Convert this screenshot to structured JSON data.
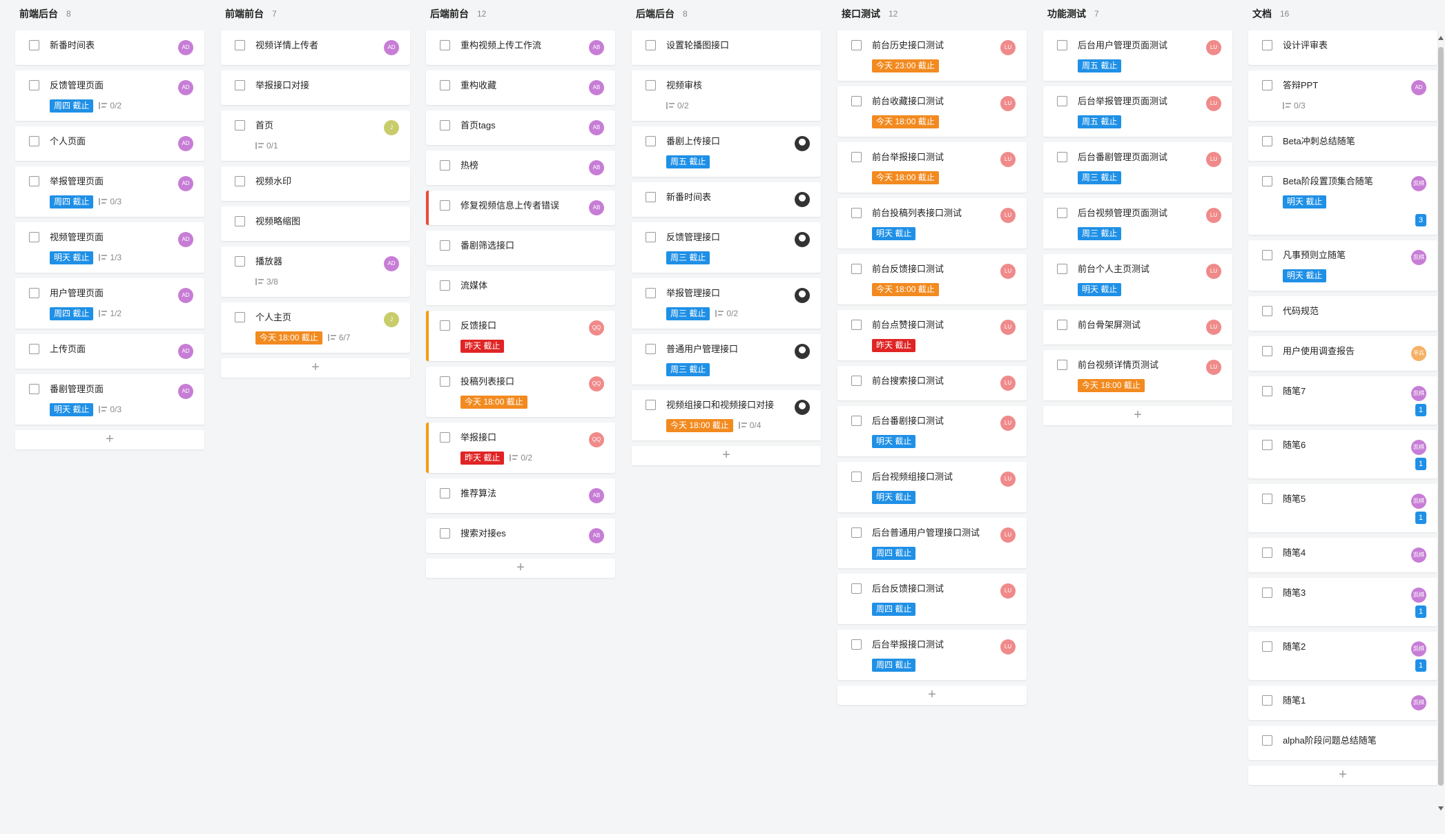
{
  "columns": [
    {
      "id": "col1",
      "title": "前端后台",
      "count": "8",
      "cards": [
        {
          "title": "新番时间表",
          "avatar": "AD",
          "avatar_color": "#c77dd6"
        },
        {
          "title": "反馈管理页面",
          "tag": "周四 截止",
          "tag_color": "blue",
          "subtasks": "0/2",
          "avatar": "AD",
          "avatar_color": "#c77dd6"
        },
        {
          "title": "个人页面",
          "avatar": "AD",
          "avatar_color": "#c77dd6"
        },
        {
          "title": "举报管理页面",
          "tag": "周四 截止",
          "tag_color": "blue",
          "subtasks": "0/3",
          "avatar": "AD",
          "avatar_color": "#c77dd6"
        },
        {
          "title": "视频管理页面",
          "tag": "明天 截止",
          "tag_color": "blue",
          "subtasks": "1/3",
          "avatar": "AD",
          "avatar_color": "#c77dd6"
        },
        {
          "title": "用户管理页面",
          "tag": "周四 截止",
          "tag_color": "blue",
          "subtasks": "1/2",
          "avatar": "AD",
          "avatar_color": "#c77dd6"
        },
        {
          "title": "上传页面",
          "avatar": "AD",
          "avatar_color": "#c77dd6"
        },
        {
          "title": "番剧管理页面",
          "tag": "明天 截止",
          "tag_color": "blue",
          "subtasks": "0/3",
          "avatar": "AD",
          "avatar_color": "#c77dd6"
        }
      ],
      "add": "+"
    },
    {
      "id": "col2",
      "title": "前端前台",
      "count": "7",
      "cards": [
        {
          "title": "视频详情上传者",
          "avatar": "AD",
          "avatar_color": "#c77dd6"
        },
        {
          "title": "举报接口对接"
        },
        {
          "title": "首页",
          "subtasks": "0/1",
          "avatar": "J",
          "avatar_color": "#c8cc6a"
        },
        {
          "title": "视频水印"
        },
        {
          "title": "视频略缩图"
        },
        {
          "title": "播放器",
          "subtasks": "3/8",
          "avatar": "AD",
          "avatar_color": "#c77dd6"
        },
        {
          "title": "个人主页",
          "tag": "今天 18:00 截止",
          "tag_color": "orange",
          "subtasks": "6/7",
          "avatar": "J",
          "avatar_color": "#c8cc6a"
        }
      ],
      "add": "+"
    },
    {
      "id": "col3",
      "title": "后端前台",
      "count": "12",
      "cards": [
        {
          "title": "重构视频上传工作流",
          "avatar": "AB",
          "avatar_color": "#c77dd6"
        },
        {
          "title": "重构收藏",
          "avatar": "AB",
          "avatar_color": "#c77dd6"
        },
        {
          "title": "首页tags",
          "avatar": "AB",
          "avatar_color": "#c77dd6"
        },
        {
          "title": "热榜",
          "avatar": "AB",
          "avatar_color": "#c77dd6"
        },
        {
          "title": "修复视频信息上传者错误",
          "avatar": "AB",
          "avatar_color": "#c77dd6",
          "accent": "red"
        },
        {
          "title": "番剧筛选接口"
        },
        {
          "title": "流媒体"
        },
        {
          "title": "反馈接口",
          "tag": "昨天 截止",
          "tag_color": "red",
          "avatar": "QQ",
          "avatar_color": "#f08a8a",
          "accent": "orange"
        },
        {
          "title": "投稿列表接口",
          "tag": "今天 18:00 截止",
          "tag_color": "orange",
          "avatar": "QQ",
          "avatar_color": "#f08a8a"
        },
        {
          "title": "举报接口",
          "tag": "昨天 截止",
          "tag_color": "red",
          "subtasks": "0/2",
          "avatar": "QQ",
          "avatar_color": "#f08a8a",
          "accent": "orange"
        },
        {
          "title": "推荐算法",
          "avatar": "AB",
          "avatar_color": "#c77dd6"
        },
        {
          "title": "搜索对接es",
          "avatar": "AB",
          "avatar_color": "#c77dd6"
        }
      ],
      "add": "+"
    },
    {
      "id": "col4",
      "title": "后端后台",
      "count": "8",
      "cards": [
        {
          "title": "设置轮播图接口"
        },
        {
          "title": "视频审核",
          "subtasks": "0/2"
        },
        {
          "title": "番剧上传接口",
          "tag": "周五 截止",
          "tag_color": "blue",
          "avatar_img": true
        },
        {
          "title": "新番时间表",
          "avatar_img": true
        },
        {
          "title": "反馈管理接口",
          "tag": "周三 截止",
          "tag_color": "blue",
          "avatar_img": true
        },
        {
          "title": "举报管理接口",
          "tag": "周三 截止",
          "tag_color": "blue",
          "subtasks": "0/2",
          "avatar_img": true
        },
        {
          "title": "普通用户管理接口",
          "tag": "周三 截止",
          "tag_color": "blue",
          "avatar_img": true
        },
        {
          "title": "视频组接口和视频接口对接",
          "tag": "今天 18:00 截止",
          "tag_color": "orange",
          "subtasks": "0/4",
          "avatar_img": true
        }
      ],
      "add": "+"
    },
    {
      "id": "col5",
      "title": "接口测试",
      "count": "12",
      "cards": [
        {
          "title": "前台历史接口测试",
          "tag": "今天 23:00 截止",
          "tag_color": "orange",
          "avatar": "LU",
          "avatar_color": "#f08a8a"
        },
        {
          "title": "前台收藏接口测试",
          "tag": "今天 18:00 截止",
          "tag_color": "orange",
          "avatar": "LU",
          "avatar_color": "#f08a8a"
        },
        {
          "title": "前台举报接口测试",
          "tag": "今天 18:00 截止",
          "tag_color": "orange",
          "avatar": "LU",
          "avatar_color": "#f08a8a"
        },
        {
          "title": "前台投稿列表接口测试",
          "tag": "明天 截止",
          "tag_color": "blue",
          "avatar": "LU",
          "avatar_color": "#f08a8a"
        },
        {
          "title": "前台反馈接口测试",
          "tag": "今天 18:00 截止",
          "tag_color": "orange",
          "avatar": "LU",
          "avatar_color": "#f08a8a"
        },
        {
          "title": "前台点赞接口测试",
          "tag": "昨天 截止",
          "tag_color": "red",
          "avatar": "LU",
          "avatar_color": "#f08a8a"
        },
        {
          "title": "前台搜索接口测试",
          "avatar": "LU",
          "avatar_color": "#f08a8a"
        },
        {
          "title": "后台番剧接口测试",
          "tag": "明天 截止",
          "tag_color": "blue",
          "avatar": "LU",
          "avatar_color": "#f08a8a"
        },
        {
          "title": "后台视频组接口测试",
          "tag": "明天 截止",
          "tag_color": "blue",
          "avatar": "LU",
          "avatar_color": "#f08a8a"
        },
        {
          "title": "后台普通用户管理接口测试",
          "tag": "周四 截止",
          "tag_color": "blue",
          "avatar": "LU",
          "avatar_color": "#f08a8a"
        },
        {
          "title": "后台反馈接口测试",
          "tag": "周四 截止",
          "tag_color": "blue",
          "avatar": "LU",
          "avatar_color": "#f08a8a"
        },
        {
          "title": "后台举报接口测试",
          "tag": "周四 截止",
          "tag_color": "blue",
          "avatar": "LU",
          "avatar_color": "#f08a8a"
        }
      ],
      "add": "+"
    },
    {
      "id": "col6",
      "title": "功能测试",
      "count": "7",
      "cards": [
        {
          "title": "后台用户管理页面测试",
          "tag": "周五 截止",
          "tag_color": "blue",
          "avatar": "LU",
          "avatar_color": "#f08a8a"
        },
        {
          "title": "后台举报管理页面测试",
          "tag": "周五 截止",
          "tag_color": "blue",
          "avatar": "LU",
          "avatar_color": "#f08a8a"
        },
        {
          "title": "后台番剧管理页面测试",
          "tag": "周三 截止",
          "tag_color": "blue",
          "avatar": "LU",
          "avatar_color": "#f08a8a"
        },
        {
          "title": "后台视频管理页面测试",
          "tag": "周三 截止",
          "tag_color": "blue",
          "avatar": "LU",
          "avatar_color": "#f08a8a"
        },
        {
          "title": "前台个人主页测试",
          "tag": "明天 截止",
          "tag_color": "blue",
          "avatar": "LU",
          "avatar_color": "#f08a8a"
        },
        {
          "title": "前台骨架屏测试",
          "avatar": "LU",
          "avatar_color": "#f08a8a"
        },
        {
          "title": "前台视频详情页测试",
          "tag": "今天 18:00 截止",
          "tag_color": "orange",
          "avatar": "LU",
          "avatar_color": "#f08a8a"
        }
      ],
      "add": "+"
    },
    {
      "id": "col7",
      "title": "文档",
      "count": "16",
      "cards": [
        {
          "title": "设计评审表"
        },
        {
          "title": "答辩PPT",
          "subtasks": "0/3",
          "avatar": "AD",
          "avatar_color": "#c77dd6"
        },
        {
          "title": "Beta冲刺总结随笔"
        },
        {
          "title": "Beta阶段置顶集合随笔",
          "tag": "明天 截止",
          "tag_color": "blue",
          "avatar": "凯棋",
          "avatar_color": "#c77dd6",
          "badge": "3"
        },
        {
          "title": "凡事预则立随笔",
          "tag": "明天 截止",
          "tag_color": "blue",
          "avatar": "凯棋",
          "avatar_color": "#c77dd6"
        },
        {
          "title": "代码规范"
        },
        {
          "title": "用户使用调查报告",
          "avatar": "平兵",
          "avatar_color": "#f5b063"
        },
        {
          "title": "随笔7",
          "avatar": "凯棋",
          "avatar_color": "#c77dd6",
          "badge": "1"
        },
        {
          "title": "随笔6",
          "avatar": "凯棋",
          "avatar_color": "#c77dd6",
          "badge": "1"
        },
        {
          "title": "随笔5",
          "avatar": "凯棋",
          "avatar_color": "#c77dd6",
          "badge": "1"
        },
        {
          "title": "随笔4",
          "avatar": "凯棋",
          "avatar_color": "#c77dd6"
        },
        {
          "title": "随笔3",
          "avatar": "凯棋",
          "avatar_color": "#c77dd6",
          "badge": "1"
        },
        {
          "title": "随笔2",
          "avatar": "凯棋",
          "avatar_color": "#c77dd6",
          "badge": "1"
        },
        {
          "title": "随笔1",
          "avatar": "凯棋",
          "avatar_color": "#c77dd6"
        },
        {
          "title": "alpha阶段问题总结随笔"
        }
      ],
      "add": "+"
    }
  ]
}
